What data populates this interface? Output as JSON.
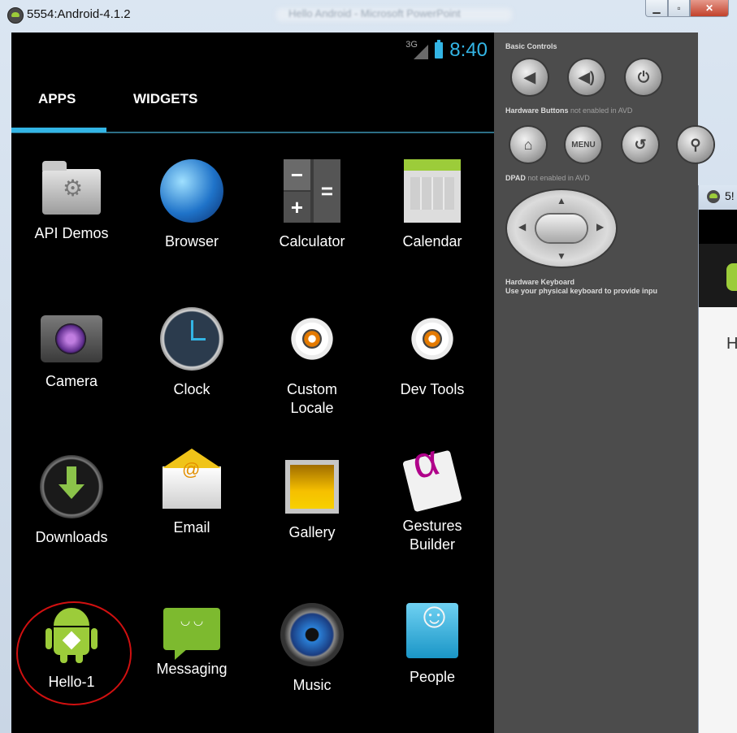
{
  "window": {
    "title": "5554:Android-4.1.2",
    "blurred_title": "Hello Android - Microsoft PowerPoint",
    "close_glyph": "✕",
    "min_glyph": "▁",
    "max_glyph": "▫"
  },
  "status": {
    "network": "3G",
    "time": "8:40"
  },
  "tabs": [
    {
      "label": "APPS",
      "selected": true
    },
    {
      "label": "WIDGETS",
      "selected": false
    }
  ],
  "apps": [
    {
      "label": "API Demos",
      "icon": "api-demos-icon"
    },
    {
      "label": "Browser",
      "icon": "browser-icon"
    },
    {
      "label": "Calculator",
      "icon": "calculator-icon"
    },
    {
      "label": "Calendar",
      "icon": "calendar-icon"
    },
    {
      "label": "Camera",
      "icon": "camera-icon"
    },
    {
      "label": "Clock",
      "icon": "clock-icon"
    },
    {
      "label": "Custom Locale",
      "icon": "custom-locale-icon"
    },
    {
      "label": "Dev Tools",
      "icon": "dev-tools-icon"
    },
    {
      "label": "Downloads",
      "icon": "downloads-icon"
    },
    {
      "label": "Email",
      "icon": "email-icon"
    },
    {
      "label": "Gallery",
      "icon": "gallery-icon"
    },
    {
      "label": "Gestures Builder",
      "icon": "gestures-builder-icon"
    },
    {
      "label": "Hello-1",
      "icon": "android-robot-icon"
    },
    {
      "label": "Messaging",
      "icon": "messaging-icon"
    },
    {
      "label": "Music",
      "icon": "music-icon"
    },
    {
      "label": "People",
      "icon": "people-icon"
    }
  ],
  "calculator_keys": [
    "−",
    "=",
    "+"
  ],
  "controls": {
    "basic_title": "Basic Controls",
    "hw_title": "Hardware Buttons",
    "hw_note": "not enabled in AVD",
    "dpad_title": "DPAD",
    "dpad_note": "not enabled in AVD",
    "kbd_title": "Hardware Keyboard",
    "kbd_note": "Use your physical keyboard to provide inpu",
    "menu_label": "MENU",
    "vol_down_glyph": "◀",
    "vol_up_glyph": "◀)",
    "power_glyph": "⏻",
    "home_glyph": "⌂",
    "back_glyph": "↺",
    "search_glyph": "⚲",
    "dpad_up": "▲",
    "dpad_down": "▼",
    "dpad_left": "◀",
    "dpad_right": "▶"
  },
  "second_window": {
    "title_fragment": "5!",
    "text_fragment": "H"
  },
  "colors": {
    "accent": "#33b5e5",
    "highlight_circle": "#d01010",
    "android_green": "#9ccc3a"
  }
}
